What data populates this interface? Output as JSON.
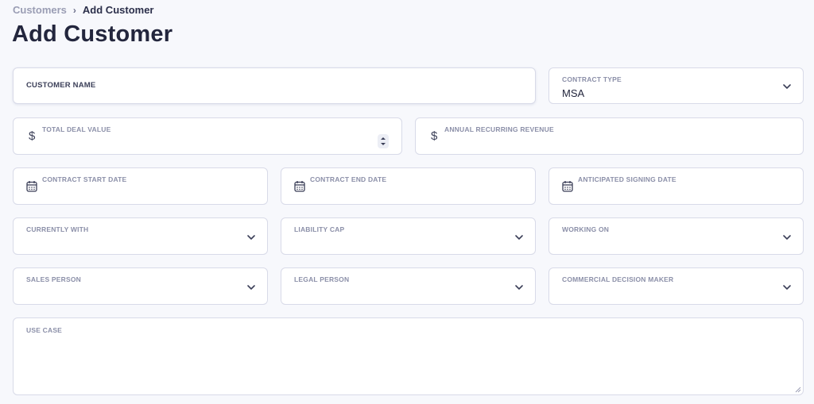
{
  "breadcrumb": {
    "parent": "Customers",
    "separator": "›",
    "current": "Add Customer"
  },
  "page_title": "Add Customer",
  "form": {
    "customer_name": {
      "label": "CUSTOMER NAME",
      "value": ""
    },
    "contract_type": {
      "label": "CONTRACT TYPE",
      "value": "MSA"
    },
    "total_deal_value": {
      "label": "TOTAL DEAL VALUE",
      "prefix": "$",
      "value": ""
    },
    "annual_recurring_revenue": {
      "label": "ANNUAL RECURRING REVENUE",
      "prefix": "$",
      "value": ""
    },
    "contract_start_date": {
      "label": "CONTRACT START DATE",
      "value": ""
    },
    "contract_end_date": {
      "label": "CONTRACT END DATE",
      "value": ""
    },
    "anticipated_signing_date": {
      "label": "ANTICIPATED SIGNING DATE",
      "value": ""
    },
    "currently_with": {
      "label": "CURRENTLY WITH",
      "value": ""
    },
    "liability_cap": {
      "label": "LIABILITY CAP",
      "value": ""
    },
    "working_on": {
      "label": "WORKING ON",
      "value": ""
    },
    "sales_person": {
      "label": "SALES PERSON",
      "value": ""
    },
    "legal_person": {
      "label": "LEGAL PERSON",
      "value": ""
    },
    "commercial_decision_maker": {
      "label": "COMMERCIAL DECISION MAKER",
      "value": ""
    },
    "use_case": {
      "label": "USE CASE",
      "value": ""
    }
  },
  "icons": {
    "dropdown": "chevron-down-icon",
    "date": "calendar-icon",
    "currency": "dollar-sign",
    "stepper": "number-stepper-icon",
    "resize": "resize-handle-icon"
  },
  "colors": {
    "background": "#f7f8fc",
    "field_border": "#d8dae8",
    "label": "#8b8fa8",
    "text": "#23263d"
  }
}
